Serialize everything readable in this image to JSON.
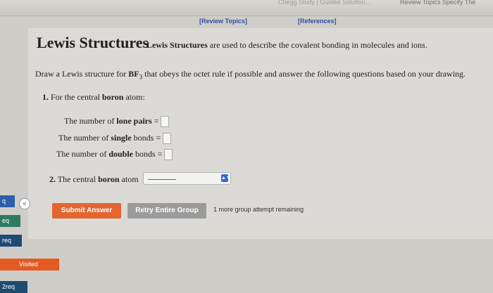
{
  "top_tabs": [
    "Chegg Study | Guided Solution...",
    "Review Topics Specify The"
  ],
  "header": {
    "review_topics": "[Review Topics]",
    "references": "[References]"
  },
  "title": {
    "main": "Lewis Structures",
    "desc_bold": "Lewis Structures",
    "desc_rest": " are used to describe the covalent bonding in molecules and ions."
  },
  "question": {
    "prefix": "Draw a Lewis structure for ",
    "formula": "BF",
    "subscript": "3",
    "suffix": " that obeys the octet rule if possible and answer the following questions based on your drawing."
  },
  "q1": {
    "num": "1.",
    "text_pre": " For the central ",
    "text_bold": "boron",
    "text_post": " atom:",
    "items": [
      {
        "pre": "The number of ",
        "bold": "lone pairs",
        "post": " ="
      },
      {
        "pre": "The number of ",
        "bold": "single",
        "post": " bonds ="
      },
      {
        "pre": "The number of ",
        "bold": "double",
        "post": " bonds ="
      }
    ]
  },
  "q2": {
    "num": "2.",
    "text_pre": " The central ",
    "text_bold": "boron",
    "text_post": " atom"
  },
  "buttons": {
    "submit": "Submit Answer",
    "retry": "Retry Entire Group",
    "attempts": "1 more group attempt remaining"
  },
  "side": {
    "collapse": "<",
    "t1": "q",
    "t2": "eq",
    "t3": "req",
    "visited": "Visited",
    "t5": "2req"
  },
  "colors": {
    "accent": "#e4652f",
    "link": "#2c4fa5",
    "select_arrow": "#2f6ad9"
  }
}
